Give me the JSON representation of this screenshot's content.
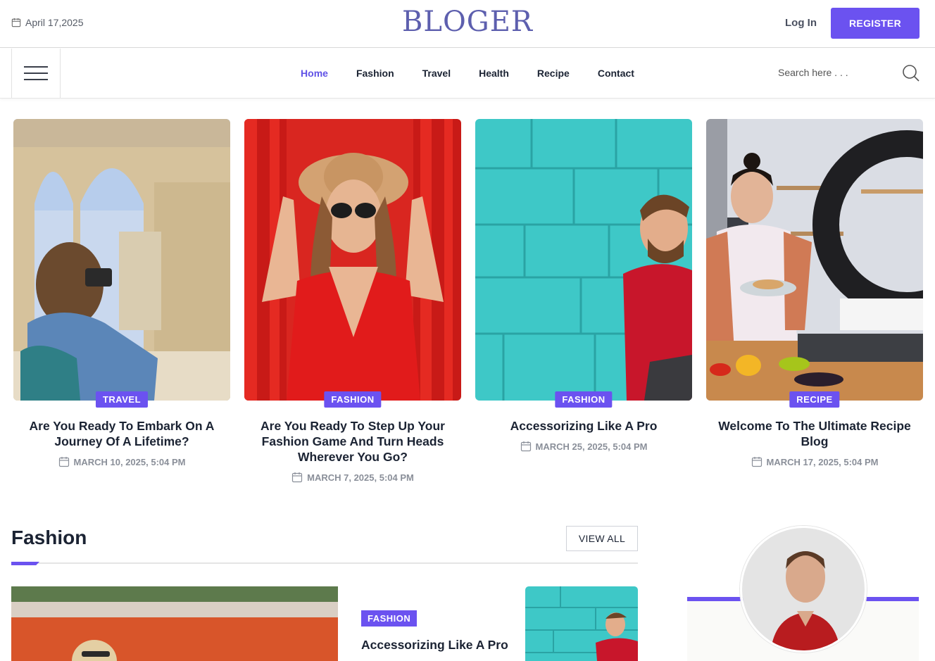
{
  "header": {
    "date": "April 17,2025",
    "logo": "BLOGER",
    "login_label": "Log In",
    "register_label": "REGISTER"
  },
  "nav": {
    "items": [
      {
        "label": "Home",
        "active": true
      },
      {
        "label": "Fashion"
      },
      {
        "label": "Travel"
      },
      {
        "label": "Health"
      },
      {
        "label": "Recipe"
      },
      {
        "label": "Contact"
      }
    ],
    "search_placeholder": "Search here . . ."
  },
  "featured": [
    {
      "category": "TRAVEL",
      "title": "Are You Ready To Embark On A Journey Of A Lifetime?",
      "date": "MARCH 10, 2025, 5:04 PM"
    },
    {
      "category": "FASHION",
      "title": "Are You Ready To Step Up Your Fashion Game And Turn Heads Wherever You Go?",
      "date": "MARCH 7, 2025, 5:04 PM"
    },
    {
      "category": "FASHION",
      "title": "Accessorizing Like A Pro",
      "date": "MARCH 25, 2025, 5:04 PM"
    },
    {
      "category": "RECIPE",
      "title": "Welcome To The Ultimate Recipe Blog",
      "date": "MARCH 17, 2025, 5:04 PM"
    }
  ],
  "fashion_section": {
    "title": "Fashion",
    "view_all_label": "VIEW ALL",
    "post_category": "FASHION",
    "post_title": "Accessorizing Like A Pro"
  },
  "colors": {
    "accent": "#6b52f0",
    "logo": "#5d5fae",
    "text_dark": "#1b2333",
    "meta_gray": "#8a8f99"
  }
}
